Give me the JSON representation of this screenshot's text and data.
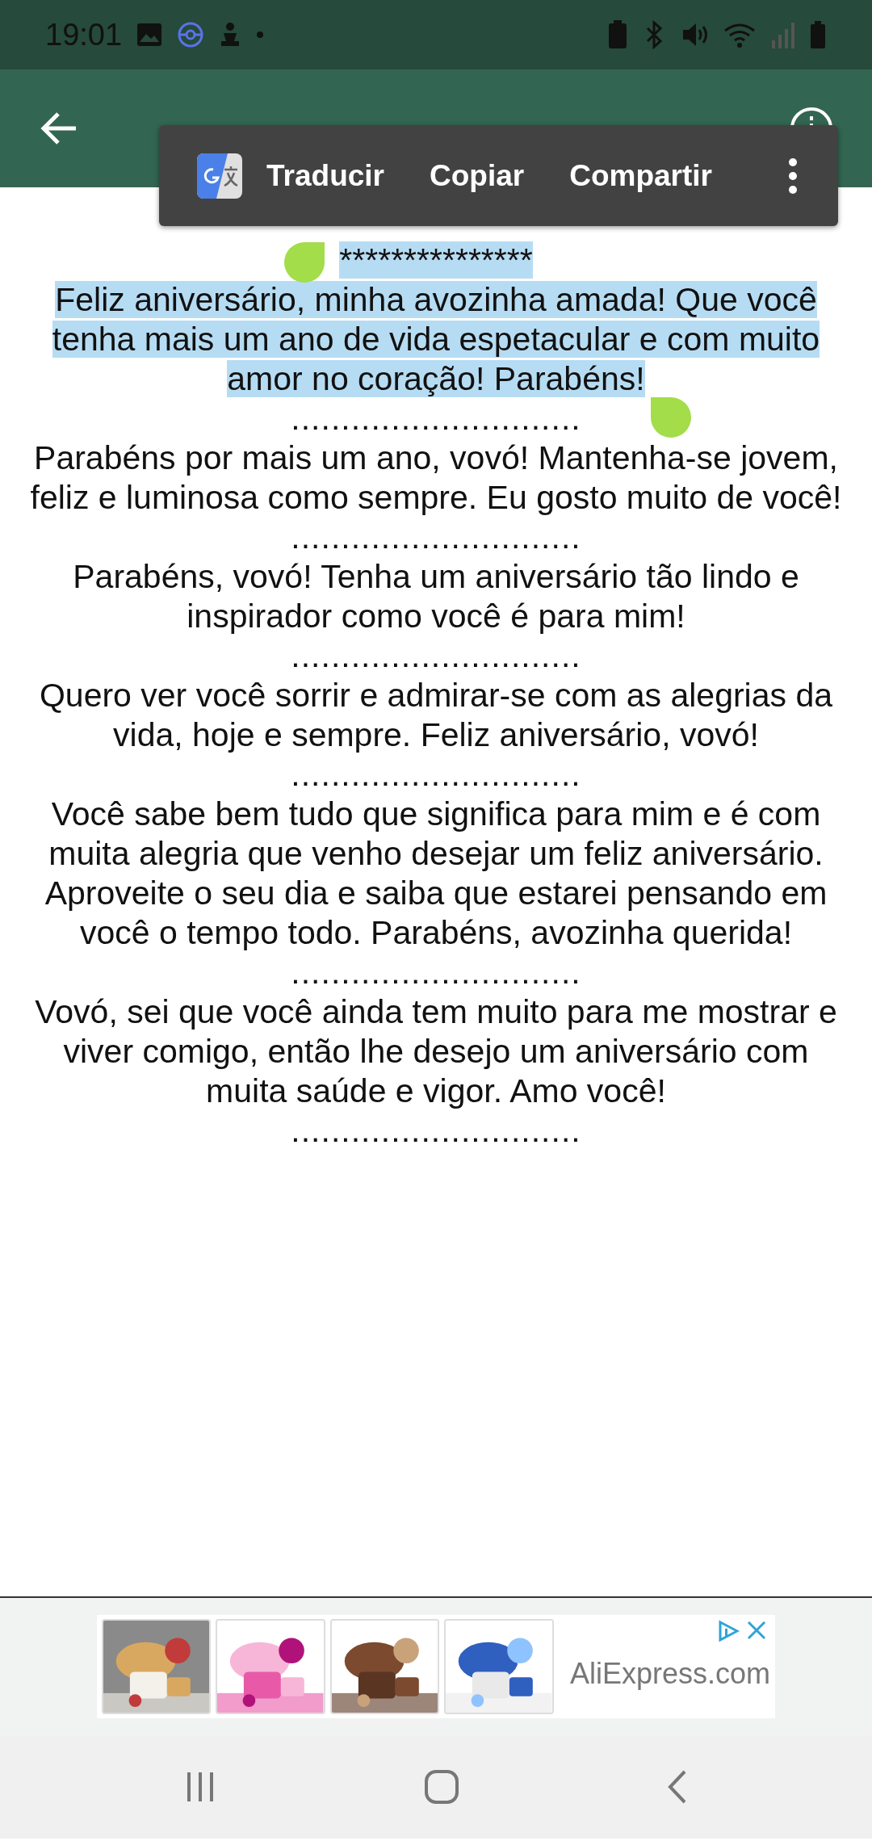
{
  "status_bar": {
    "time": "19:01"
  },
  "selection_menu": {
    "items": [
      "Traducir",
      "Copiar",
      "Compartir"
    ]
  },
  "message": [
    {
      "kind": "text",
      "lines": [
        "***************"
      ],
      "selected": true
    },
    {
      "kind": "text",
      "lines": [
        "Feliz aniversário, minha avozinha amada! Que você",
        "tenha mais um ano de vida espetacular e com muito",
        "amor no coração! Parabéns!"
      ],
      "selected": true
    },
    {
      "kind": "separator",
      "lines": [
        "............................."
      ],
      "selected": false
    },
    {
      "kind": "text",
      "lines": [
        "Parabéns por mais um ano, vovó! Mantenha-se jovem,",
        "feliz e luminosa como sempre. Eu gosto muito de você!"
      ],
      "selected": false
    },
    {
      "kind": "separator",
      "lines": [
        "............................."
      ],
      "selected": false
    },
    {
      "kind": "text",
      "lines": [
        "Parabéns, vovó! Tenha um aniversário tão lindo e",
        "inspirador como você é para mim!"
      ],
      "selected": false
    },
    {
      "kind": "separator",
      "lines": [
        "............................."
      ],
      "selected": false
    },
    {
      "kind": "text",
      "lines": [
        "Quero ver você sorrir e admirar-se com as alegrias da",
        "vida, hoje e sempre. Feliz aniversário, vovó!"
      ],
      "selected": false
    },
    {
      "kind": "separator",
      "lines": [
        "............................."
      ],
      "selected": false
    },
    {
      "kind": "text",
      "lines": [
        "Você sabe bem tudo que significa para mim e é com",
        "muita alegria que venho desejar um feliz aniversário.",
        "Aproveite o seu dia e saiba que estarei pensando em",
        "você o tempo todo. Parabéns, avozinha querida!"
      ],
      "selected": false
    },
    {
      "kind": "separator",
      "lines": [
        "............................."
      ],
      "selected": false
    },
    {
      "kind": "text",
      "lines": [
        "Vovó, sei que você ainda tem muito para me mostrar e",
        "viver comigo, então lhe desejo um aniversário com",
        "muita saúde e vigor. Amo você!"
      ],
      "selected": false
    },
    {
      "kind": "separator",
      "lines": [
        "............................."
      ],
      "selected": false
    }
  ],
  "ad": {
    "advertiser": "AliExpress.com"
  }
}
